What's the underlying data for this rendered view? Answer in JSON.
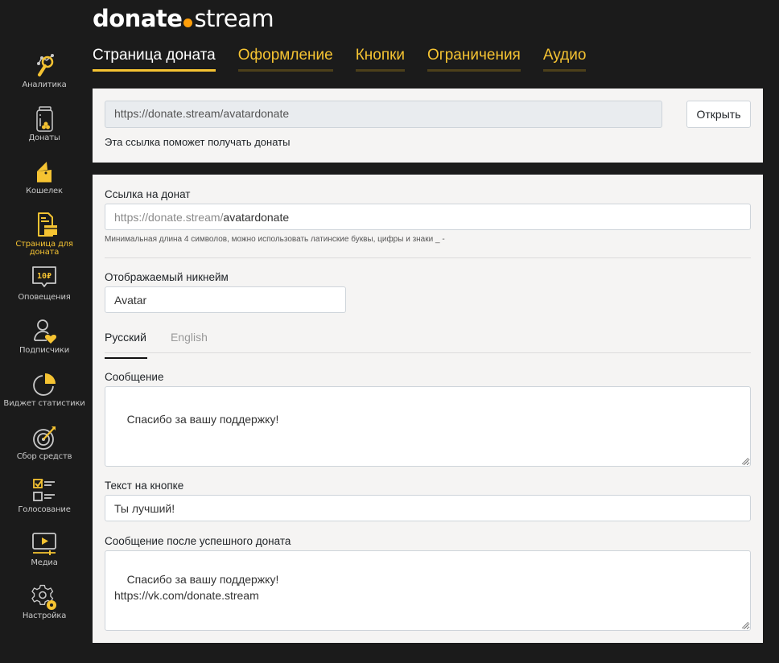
{
  "brand": {
    "part1": "donate",
    "part2": "stream",
    "dot_color": "#ff9f0a"
  },
  "colors": {
    "accent": "#f5c332",
    "background": "#1b1b1b",
    "card": "#f5f4f3"
  },
  "sidebar": {
    "items": [
      {
        "label": "Аналитика",
        "icon": "analytics-icon",
        "active": false
      },
      {
        "label": "Донаты",
        "icon": "donations-jar-icon",
        "active": false
      },
      {
        "label": "Кошелек",
        "icon": "wallet-icon",
        "active": false
      },
      {
        "label": "Страница для доната",
        "icon": "donation-page-icon",
        "active": true
      },
      {
        "label": "Оповещения",
        "icon": "alerts-icon",
        "active": false
      },
      {
        "label": "Подписчики",
        "icon": "subscribers-icon",
        "active": false
      },
      {
        "label": "Виджет статистики",
        "icon": "stats-widget-icon",
        "active": false
      },
      {
        "label": "Сбор средств",
        "icon": "fundraising-target-icon",
        "active": false
      },
      {
        "label": "Голосование",
        "icon": "voting-icon",
        "active": false
      },
      {
        "label": "Медиа",
        "icon": "media-icon",
        "active": false
      },
      {
        "label": "Настройка",
        "icon": "settings-icon",
        "active": false
      }
    ]
  },
  "tabs": [
    {
      "label": "Страница доната",
      "active": true
    },
    {
      "label": "Оформление",
      "active": false
    },
    {
      "label": "Кнопки",
      "active": false
    },
    {
      "label": "Ограничения",
      "active": false
    },
    {
      "label": "Аудио",
      "active": false
    }
  ],
  "link_card": {
    "url": "https://donate.stream/avatardonate",
    "open_button": "Открыть",
    "hint": "Эта ссылка поможет получать донаты"
  },
  "form": {
    "link_label": "Ссылка на донат",
    "link_prefix": "https://donate.stream/",
    "link_value": "avatardonate",
    "link_hint": "Минимальная длина 4 символов, можно использовать латинские буквы, цифры и знаки _ -",
    "nickname_label": "Отображаемый никнейм",
    "nickname_value": "Avatar",
    "lang_tabs": [
      {
        "label": "Русский",
        "active": true
      },
      {
        "label": "English",
        "active": false
      }
    ],
    "message_label": "Сообщение",
    "message_value": "Спасибо за вашу поддержку!",
    "button_text_label": "Текст на кнопке",
    "button_text_value": "Ты лучший!",
    "success_label": "Сообщение после успешного доната",
    "success_value": "Спасибо за вашу поддержку!\nhttps://vk.com/donate.stream"
  }
}
